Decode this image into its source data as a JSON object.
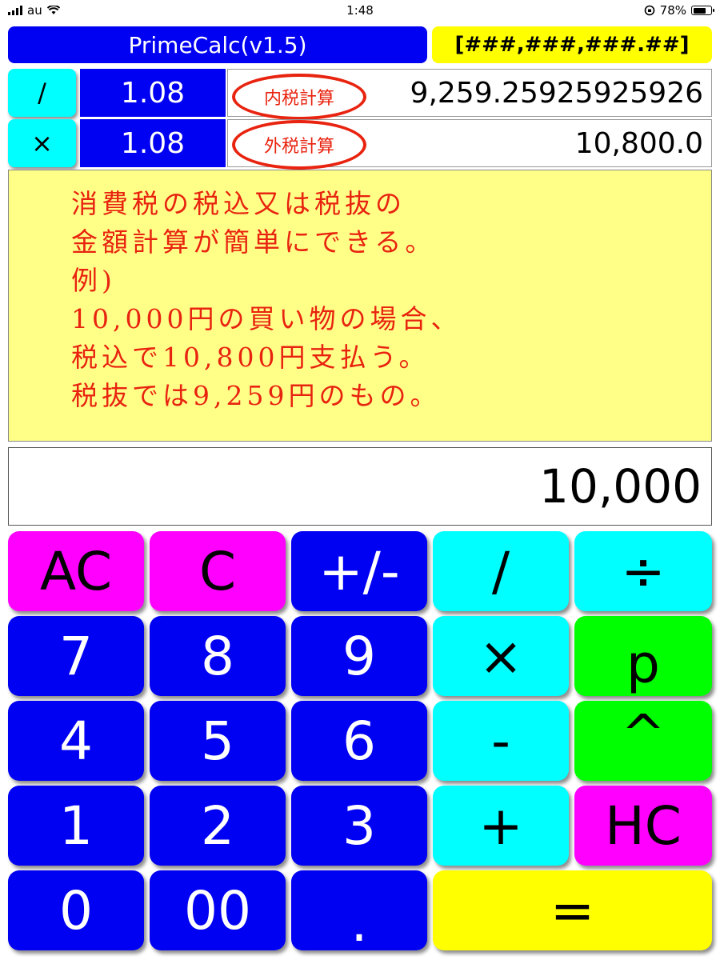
{
  "status_bar": {
    "carrier": "au",
    "time": "1:48",
    "battery": "78%",
    "battery_level": 0.78
  },
  "header": {
    "title": "PrimeCalc(v1.5)",
    "format": "[###,###,###.##]"
  },
  "tax_rows": [
    {
      "operator": "/",
      "rate": "1.08",
      "stamp": "内税計算",
      "result": "9,259.25925925926"
    },
    {
      "operator": "×",
      "rate": "1.08",
      "stamp": "外税計算",
      "result": "10,800.0"
    }
  ],
  "note_lines": [
    "消費税の税込又は税抜の",
    "金額計算が簡単にできる。",
    "例)",
    "10,000円の買い物の場合、",
    "税込で10,800円支払う。",
    "税抜では9,259円のもの。"
  ],
  "display": {
    "value": "10,000"
  },
  "keypad": {
    "ac": "AC",
    "c": "C",
    "sign": "+/-",
    "slash": "/",
    "divide": "÷",
    "seven": "7",
    "eight": "8",
    "nine": "9",
    "multiply": "×",
    "prime": "p",
    "four": "4",
    "five": "5",
    "six": "6",
    "minus": "-",
    "power": "^",
    "one": "1",
    "two": "2",
    "three": "3",
    "plus": "+",
    "hc": "HC",
    "zero": "0",
    "double_zero": "00",
    "dot": ".",
    "equals": "="
  },
  "colors": {
    "blue": "#0000f2",
    "cyan": "#00ffff",
    "magenta": "#ff00ff",
    "green": "#00ff00",
    "yellow": "#ffff00",
    "note_bg": "#ffff88",
    "stamp_red": "#e8230f"
  }
}
